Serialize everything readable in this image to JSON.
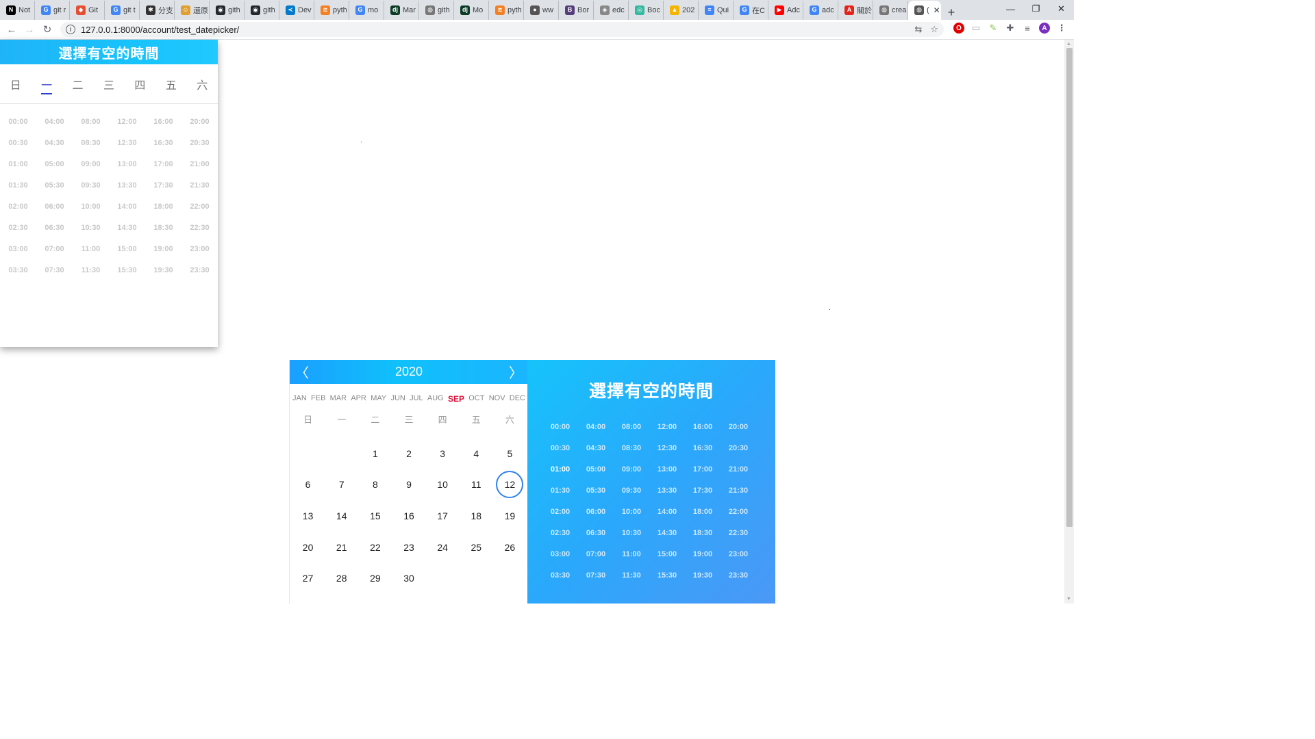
{
  "browser": {
    "tabs": [
      {
        "label": "Not",
        "icon": "notion-icon",
        "color": "#000000",
        "glyph": "N"
      },
      {
        "label": "git r",
        "icon": "google-icon",
        "color": "#4285f4",
        "glyph": "G"
      },
      {
        "label": "Git",
        "icon": "git-icon",
        "color": "#e84d31",
        "glyph": "◆"
      },
      {
        "label": "git t",
        "icon": "google-icon",
        "color": "#4285f4",
        "glyph": "G"
      },
      {
        "label": "分支",
        "icon": "app-icon",
        "color": "#333333",
        "glyph": "✱"
      },
      {
        "label": "還原",
        "icon": "avatar-icon",
        "color": "#e0a030",
        "glyph": "☺"
      },
      {
        "label": "gith",
        "icon": "github-icon",
        "color": "#24292e",
        "glyph": "◉"
      },
      {
        "label": "gith",
        "icon": "github-icon",
        "color": "#24292e",
        "glyph": "◉"
      },
      {
        "label": "Dev",
        "icon": "vscode-icon",
        "color": "#007acc",
        "glyph": "≺"
      },
      {
        "label": "pyth",
        "icon": "python-icon",
        "color": "#f48024",
        "glyph": "≋"
      },
      {
        "label": "mo",
        "icon": "google-icon",
        "color": "#4285f4",
        "glyph": "G"
      },
      {
        "label": "Mar",
        "icon": "django-icon",
        "color": "#0c3c26",
        "glyph": "dj"
      },
      {
        "label": "gith",
        "icon": "globe-icon",
        "color": "#777777",
        "glyph": "◍"
      },
      {
        "label": "Mo",
        "icon": "django-icon",
        "color": "#0c3c26",
        "glyph": "dj"
      },
      {
        "label": "pyth",
        "icon": "python-icon",
        "color": "#f48024",
        "glyph": "≋"
      },
      {
        "label": "ww",
        "icon": "elephant-icon",
        "color": "#555555",
        "glyph": "●"
      },
      {
        "label": "Bor",
        "icon": "bootstrap-icon",
        "color": "#563d7c",
        "glyph": "B"
      },
      {
        "label": "edc",
        "icon": "diamond-icon",
        "color": "#888888",
        "glyph": "◈"
      },
      {
        "label": "Boc",
        "icon": "circle-icon",
        "color": "#35b8a0",
        "glyph": "◎"
      },
      {
        "label": "202",
        "icon": "drive-icon",
        "color": "#f4b400",
        "glyph": "▲"
      },
      {
        "label": "Qui",
        "icon": "docs-icon",
        "color": "#4285f4",
        "glyph": "≡"
      },
      {
        "label": "在C",
        "icon": "google-icon",
        "color": "#4285f4",
        "glyph": "G"
      },
      {
        "label": "Adc",
        "icon": "youtube-icon",
        "color": "#ff0000",
        "glyph": "▶"
      },
      {
        "label": "adc",
        "icon": "google-icon",
        "color": "#4285f4",
        "glyph": "G"
      },
      {
        "label": "關於",
        "icon": "adobe-icon",
        "color": "#e1251b",
        "glyph": "A"
      },
      {
        "label": "crea",
        "icon": "globe-icon",
        "color": "#777777",
        "glyph": "◍"
      },
      {
        "label": "(",
        "icon": "globe-icon",
        "color": "#555555",
        "glyph": "◍",
        "active": true
      }
    ],
    "new_tab": "+",
    "window_controls": {
      "minimize": "—",
      "restore": "❐",
      "close": "✕"
    },
    "nav": {
      "back": "←",
      "forward": "→",
      "reload": "↻"
    },
    "url": "127.0.0.1:8000/account/test_datepicker/",
    "omnibox_icons": [
      "translate-icon",
      "star-icon"
    ],
    "extensions": [
      {
        "name": "opera-ext-icon",
        "color": "#e00000",
        "glyph": "O"
      },
      {
        "name": "screen-ext-icon",
        "color": "#9aa0a6",
        "glyph": "▭"
      },
      {
        "name": "note-ext-icon",
        "color": "#8bc34a",
        "glyph": "✎"
      },
      {
        "name": "puzzle-icon",
        "color": "#5f6368",
        "glyph": "✚"
      },
      {
        "name": "media-icon",
        "color": "#5f6368",
        "glyph": "≡"
      },
      {
        "name": "profile-avatar-icon",
        "color": "#7b2fbf",
        "glyph": "A"
      },
      {
        "name": "menu-icon",
        "color": "#5f6368",
        "glyph": "⋮"
      }
    ]
  },
  "panel1": {
    "title": "選擇有空的時間",
    "weekdays": [
      "日",
      "一",
      "二",
      "三",
      "四",
      "五",
      "六"
    ],
    "selected_weekday": 1,
    "times": [
      "00:00",
      "04:00",
      "08:00",
      "12:00",
      "16:00",
      "20:00",
      "00:30",
      "04:30",
      "08:30",
      "12:30",
      "16:30",
      "20:30",
      "01:00",
      "05:00",
      "09:00",
      "13:00",
      "17:00",
      "21:00",
      "01:30",
      "05:30",
      "09:30",
      "13:30",
      "17:30",
      "21:30",
      "02:00",
      "06:00",
      "10:00",
      "14:00",
      "18:00",
      "22:00",
      "02:30",
      "06:30",
      "10:30",
      "14:30",
      "18:30",
      "22:30",
      "03:00",
      "07:00",
      "11:00",
      "15:00",
      "19:00",
      "23:00",
      "03:30",
      "07:30",
      "11:30",
      "15:30",
      "19:30",
      "23:30"
    ]
  },
  "panel2": {
    "calendar": {
      "prev": "〈",
      "next": "〉",
      "year": "2020",
      "months": [
        "JAN",
        "FEB",
        "MAR",
        "APR",
        "MAY",
        "JUN",
        "JUL",
        "AUG",
        "SEP",
        "OCT",
        "NOV",
        "DEC"
      ],
      "selected_month": 8,
      "weekdays": [
        "日",
        "一",
        "二",
        "三",
        "四",
        "五",
        "六"
      ],
      "leading_blanks": 2,
      "days": [
        "1",
        "2",
        "3",
        "4",
        "5",
        "6",
        "7",
        "8",
        "9",
        "10",
        "11",
        "12",
        "13",
        "14",
        "15",
        "16",
        "17",
        "18",
        "19",
        "20",
        "21",
        "22",
        "23",
        "24",
        "25",
        "26",
        "27",
        "28",
        "29",
        "30"
      ],
      "selected_day": "12"
    },
    "time_panel": {
      "title": "選擇有空的時間",
      "selected_time": "01:00",
      "times": [
        "00:00",
        "04:00",
        "08:00",
        "12:00",
        "16:00",
        "20:00",
        "00:30",
        "04:30",
        "08:30",
        "12:30",
        "16:30",
        "20:30",
        "01:00",
        "05:00",
        "09:00",
        "13:00",
        "17:00",
        "21:00",
        "01:30",
        "05:30",
        "09:30",
        "13:30",
        "17:30",
        "21:30",
        "02:00",
        "06:00",
        "10:00",
        "14:00",
        "18:00",
        "22:00",
        "02:30",
        "06:30",
        "10:30",
        "14:30",
        "18:30",
        "22:30",
        "03:00",
        "07:00",
        "11:00",
        "15:00",
        "19:00",
        "23:00",
        "03:30",
        "07:30",
        "11:30",
        "15:30",
        "19:30",
        "23:30"
      ]
    }
  },
  "colors": {
    "accent": "#18c2fb",
    "selected_month": "#e0103a",
    "selected_day_ring": "#2f83f0",
    "selected_weekday": "#2a3dcc"
  }
}
